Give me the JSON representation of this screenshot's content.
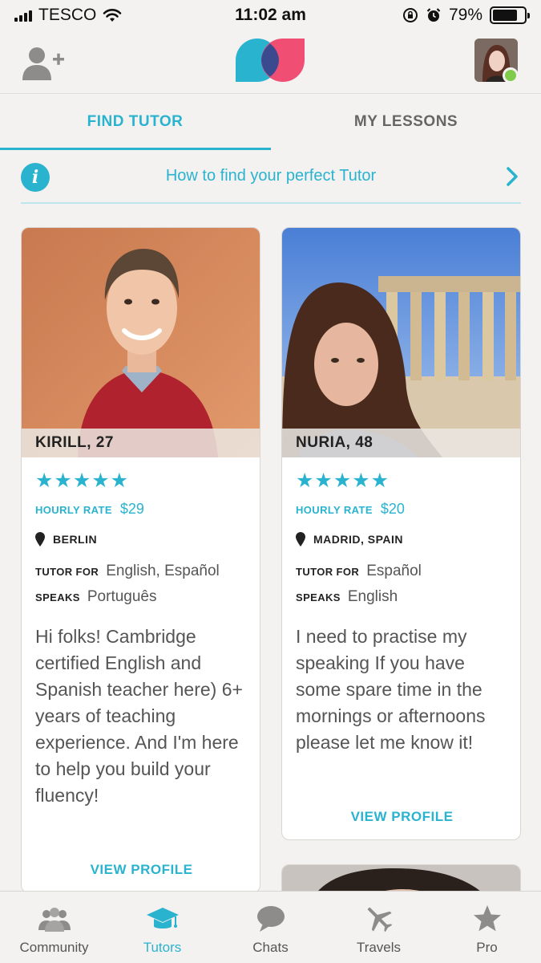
{
  "status_bar": {
    "carrier": "TESCO",
    "time": "11:02 am",
    "battery": "79%",
    "battery_level": 0.79
  },
  "header": {
    "add_friend_icon": "add-user-icon",
    "logo_icon": "app-logo-icon",
    "avatar_status": "online"
  },
  "tabs": [
    {
      "label": "FIND TUTOR",
      "active": true
    },
    {
      "label": "MY LESSONS",
      "active": false
    }
  ],
  "info_banner": {
    "text": "How to find your perfect Tutor",
    "icon": "info-icon"
  },
  "labels": {
    "hourly_rate": "HOURLY RATE",
    "tutor_for": "TUTOR FOR",
    "speaks": "SPEAKS",
    "view_profile": "VIEW PROFILE"
  },
  "tutors": [
    {
      "name": "KIRILL, 27",
      "rating_stars": "★★★★★",
      "rating": 5,
      "hourly_rate": "$29",
      "location": "BERLIN",
      "tutor_for": "English, Español",
      "speaks": "Português",
      "bio": "Hi folks! Cambridge certified English and Spanish teacher here) 6+ years of teaching experience. And I'm here to help you build your fluency!"
    },
    {
      "name": "NURIA, 48",
      "rating_stars": "★★★★★",
      "rating": 5,
      "hourly_rate": "$20",
      "location": "MADRID, SPAIN",
      "tutor_for": "Español",
      "speaks": "English",
      "bio": "I need to practise my speaking If you have some spare time in the mornings or afternoons please let me know it!"
    }
  ],
  "bottom_nav": [
    {
      "label": "Community",
      "icon": "community-icon",
      "active": false
    },
    {
      "label": "Tutors",
      "icon": "graduation-cap-icon",
      "active": true
    },
    {
      "label": "Chats",
      "icon": "chat-bubble-icon",
      "active": false
    },
    {
      "label": "Travels",
      "icon": "airplane-icon",
      "active": false
    },
    {
      "label": "Pro",
      "icon": "star-icon",
      "active": false
    }
  ],
  "colors": {
    "accent": "#2ab3cf",
    "logo_blue": "#2ab3cf",
    "logo_pink": "#f0456d",
    "online": "#7fcb4b"
  }
}
